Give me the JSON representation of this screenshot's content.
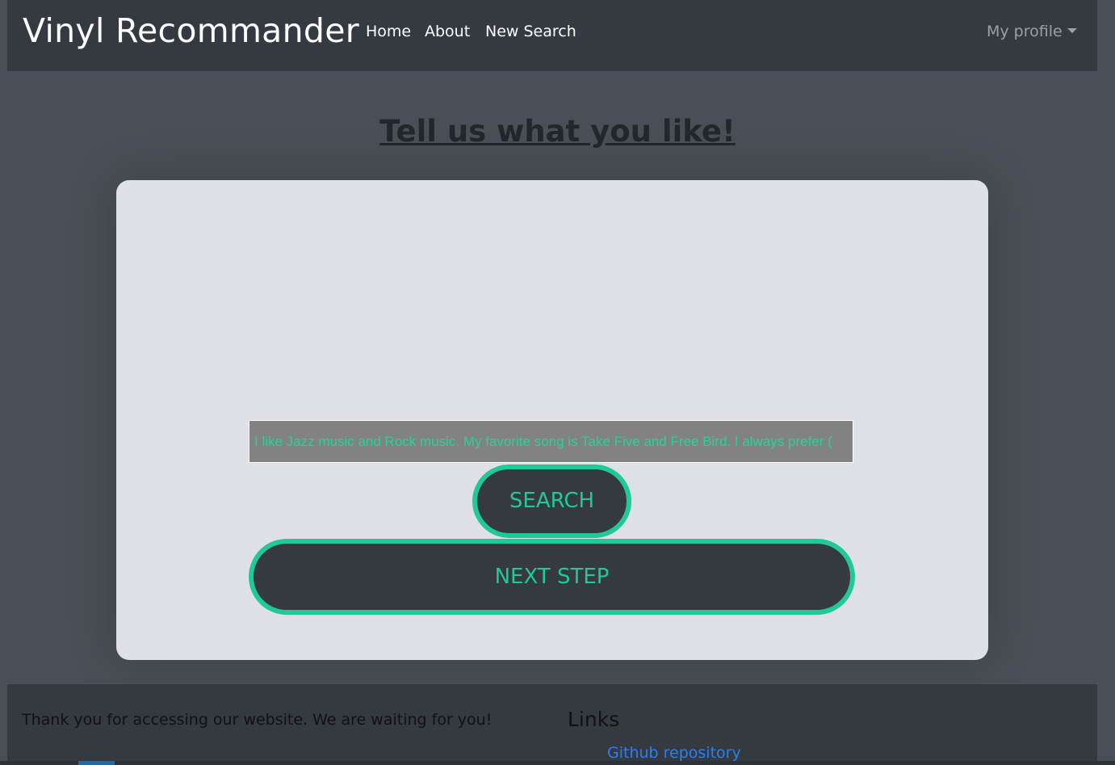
{
  "navbar": {
    "brand": "Vinyl Recommander",
    "links": [
      {
        "label": "Home"
      },
      {
        "label": "About"
      },
      {
        "label": "New Search"
      }
    ],
    "profile_label": "My profile"
  },
  "main": {
    "title": "Tell us what you like!",
    "search_value": "I like Jazz music and Rock music. My favorite song is Take Five and Free Bird. I always prefer (",
    "search_button": "SEARCH",
    "next_button": "NEXT STEP"
  },
  "footer": {
    "thanks_text": "Thank you for accessing our website. We are waiting for you!",
    "links_title": "Links",
    "github_link": "Github repository"
  },
  "colors": {
    "accent": "#20c997",
    "navbar_bg": "#343a40",
    "page_bg": "#4a4e56",
    "card_bg": "#dee1e6",
    "input_bg": "#828282",
    "link": "#2f7ef0"
  }
}
